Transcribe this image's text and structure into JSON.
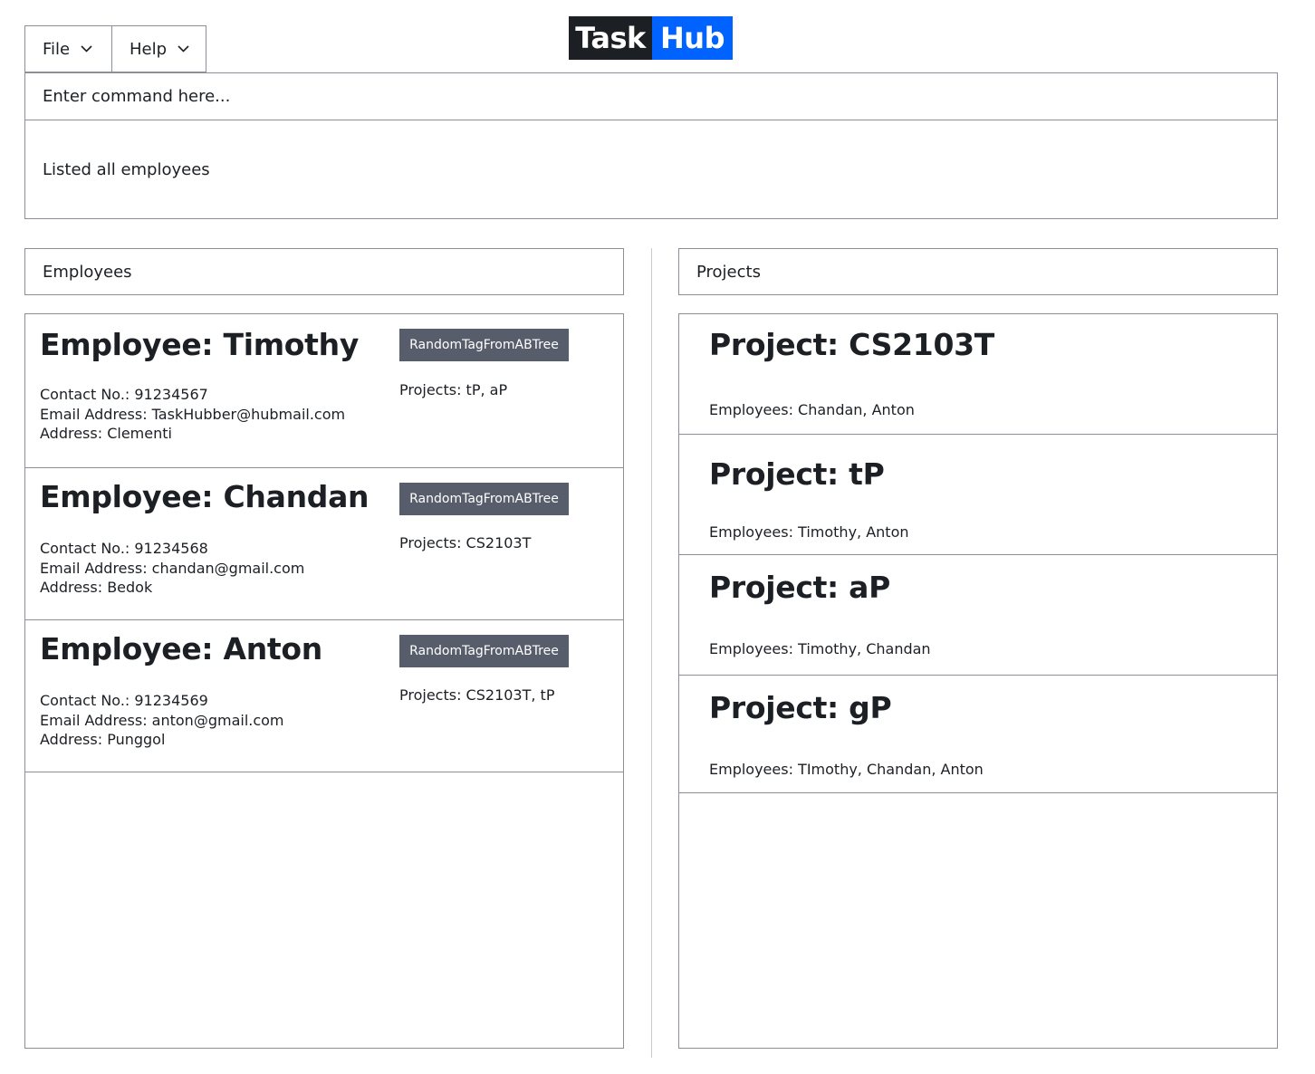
{
  "menu": {
    "file_label": "File",
    "help_label": "Help"
  },
  "logo": {
    "part1": "Task",
    "part2": "Hub"
  },
  "command": {
    "placeholder": "Enter command here..."
  },
  "result": {
    "text": "Listed all employees"
  },
  "employees_panel": {
    "header": "Employees",
    "items": [
      {
        "title": "Employee: Timothy",
        "contact": "Contact No.: 91234567",
        "email": "Email Address: TaskHubber@hubmail.com",
        "address": "Address: Clementi",
        "tag": "RandomTagFromABTree",
        "projects": "Projects: tP, aP"
      },
      {
        "title": "Employee: Chandan",
        "contact": "Contact No.: 91234568",
        "email": "Email Address: chandan@gmail.com",
        "address": "Address: Bedok",
        "tag": "RandomTagFromABTree",
        "projects": "Projects: CS2103T"
      },
      {
        "title": "Employee: Anton",
        "contact": "Contact No.: 91234569",
        "email": "Email Address: anton@gmail.com",
        "address": "Address: Punggol",
        "tag": "RandomTagFromABTree",
        "projects": "Projects: CS2103T, tP"
      }
    ]
  },
  "projects_panel": {
    "header": "Projects",
    "items": [
      {
        "title": "Project: CS2103T",
        "employees": "Employees: Chandan, Anton"
      },
      {
        "title": "Project: tP",
        "employees": "Employees: Timothy, Anton"
      },
      {
        "title": "Project: aP",
        "employees": "Employees: Timothy, Chandan"
      },
      {
        "title": "Project: gP",
        "employees": "Employees: TImothy, Chandan, Anton"
      }
    ]
  },
  "colors": {
    "logo_dark": "#1c1f24",
    "logo_blue": "#0062ff",
    "tag_bg": "#575d6b",
    "border": "#8a8f98"
  }
}
